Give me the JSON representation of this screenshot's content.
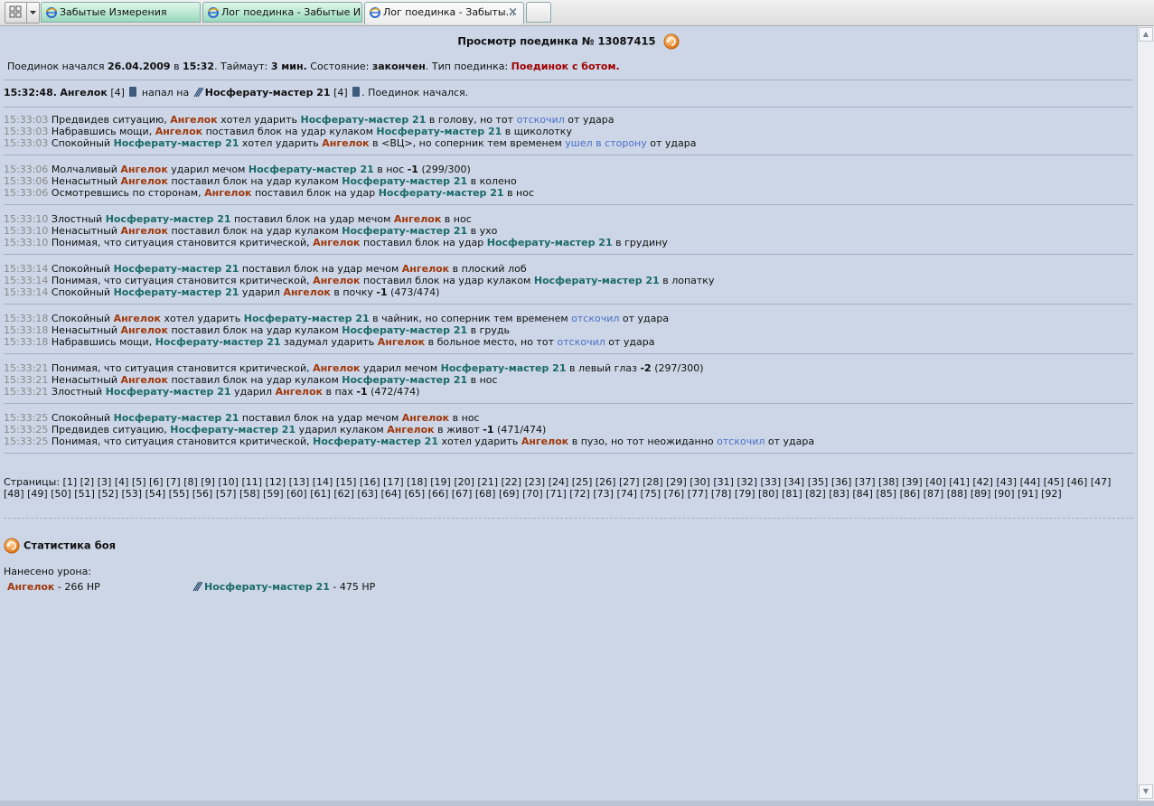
{
  "tabs": [
    {
      "label": "Забытые Измерения",
      "state": "inactive"
    },
    {
      "label": "Лог поединка - Забытые И...",
      "state": "inactive"
    },
    {
      "label": "Лог поединка - Забыты...",
      "state": "active"
    }
  ],
  "colors": {
    "fighter_a": "#a0380c",
    "fighter_b": "#1a6a6a",
    "dodge": "#4a6fc8",
    "page_bg": "#ccd6e6"
  },
  "header": {
    "title": "Просмотр поединка № 13087415"
  },
  "info": {
    "started_label": "Поединок начался",
    "date": "26.04.2009",
    "in_label": "в",
    "time": "15:32",
    "timeout_label": ". Таймаут:",
    "timeout": "3 мин.",
    "state_label": "Состояние:",
    "state": "закончен",
    "type_label": ". Тип поединка:",
    "type": "Поединок с ботом."
  },
  "start": {
    "time": "15:32:48.",
    "fighter_a": "Ангелок",
    "level_a": "[4]",
    "verb": "напал на",
    "fighter_b": "Носферату-мастер 21",
    "level_b": "[4]",
    "suffix": ". Поединок начался."
  },
  "rounds": [
    {
      "lines": [
        {
          "time": "15:33:03",
          "parts": [
            {
              "k": "p",
              "t": "Предвидев ситуацию, "
            },
            {
              "k": "a",
              "t": "Ангелок"
            },
            {
              "k": "p",
              "t": " хотел ударить "
            },
            {
              "k": "n",
              "t": "Носферату-мастер 21"
            },
            {
              "k": "p",
              "t": " в голову, но тот "
            },
            {
              "k": "d",
              "t": "отскочил"
            },
            {
              "k": "p",
              "t": " от удара"
            }
          ]
        },
        {
          "time": "15:33:03",
          "parts": [
            {
              "k": "p",
              "t": "Набравшись мощи, "
            },
            {
              "k": "a",
              "t": "Ангелок"
            },
            {
              "k": "p",
              "t": " поставил блок на удар кулаком "
            },
            {
              "k": "n",
              "t": "Носферату-мастер 21"
            },
            {
              "k": "p",
              "t": " в щиколотку"
            }
          ]
        },
        {
          "time": "15:33:03",
          "parts": [
            {
              "k": "p",
              "t": "Спокойный "
            },
            {
              "k": "n",
              "t": "Носферату-мастер 21"
            },
            {
              "k": "p",
              "t": " хотел ударить "
            },
            {
              "k": "a",
              "t": "Ангелок"
            },
            {
              "k": "p",
              "t": " в <ВЦ>, но соперник тем временем "
            },
            {
              "k": "d",
              "t": "ушел в сторону"
            },
            {
              "k": "p",
              "t": " от удара"
            }
          ]
        }
      ]
    },
    {
      "lines": [
        {
          "time": "15:33:06",
          "parts": [
            {
              "k": "p",
              "t": "Молчаливый "
            },
            {
              "k": "a",
              "t": "Ангелок"
            },
            {
              "k": "p",
              "t": " ударил мечом "
            },
            {
              "k": "n",
              "t": "Носферату-мастер 21"
            },
            {
              "k": "p",
              "t": " в нос "
            },
            {
              "k": "b",
              "t": "-1"
            },
            {
              "k": "p",
              "t": " (299/300)"
            }
          ]
        },
        {
          "time": "15:33:06",
          "parts": [
            {
              "k": "p",
              "t": "Ненасытный "
            },
            {
              "k": "a",
              "t": "Ангелок"
            },
            {
              "k": "p",
              "t": " поставил блок на удар кулаком "
            },
            {
              "k": "n",
              "t": "Носферату-мастер 21"
            },
            {
              "k": "p",
              "t": " в колено"
            }
          ]
        },
        {
          "time": "15:33:06",
          "parts": [
            {
              "k": "p",
              "t": "Осмотревшись по сторонам, "
            },
            {
              "k": "a",
              "t": "Ангелок"
            },
            {
              "k": "p",
              "t": " поставил блок на удар "
            },
            {
              "k": "n",
              "t": "Носферату-мастер 21"
            },
            {
              "k": "p",
              "t": " в нос"
            }
          ]
        }
      ]
    },
    {
      "lines": [
        {
          "time": "15:33:10",
          "parts": [
            {
              "k": "p",
              "t": "Злостный "
            },
            {
              "k": "n",
              "t": "Носферату-мастер 21"
            },
            {
              "k": "p",
              "t": " поставил блок на удар мечом "
            },
            {
              "k": "a",
              "t": "Ангелок"
            },
            {
              "k": "p",
              "t": " в нос"
            }
          ]
        },
        {
          "time": "15:33:10",
          "parts": [
            {
              "k": "p",
              "t": "Ненасытный "
            },
            {
              "k": "a",
              "t": "Ангелок"
            },
            {
              "k": "p",
              "t": " поставил блок на удар кулаком "
            },
            {
              "k": "n",
              "t": "Носферату-мастер 21"
            },
            {
              "k": "p",
              "t": " в ухо"
            }
          ]
        },
        {
          "time": "15:33:10",
          "parts": [
            {
              "k": "p",
              "t": "Понимая, что ситуация становится критической, "
            },
            {
              "k": "a",
              "t": "Ангелок"
            },
            {
              "k": "p",
              "t": " поставил блок на удар "
            },
            {
              "k": "n",
              "t": "Носферату-мастер 21"
            },
            {
              "k": "p",
              "t": " в грудину"
            }
          ]
        }
      ]
    },
    {
      "lines": [
        {
          "time": "15:33:14",
          "parts": [
            {
              "k": "p",
              "t": "Спокойный "
            },
            {
              "k": "n",
              "t": "Носферату-мастер 21"
            },
            {
              "k": "p",
              "t": " поставил блок на удар мечом "
            },
            {
              "k": "a",
              "t": "Ангелок"
            },
            {
              "k": "p",
              "t": " в плоский лоб"
            }
          ]
        },
        {
          "time": "15:33:14",
          "parts": [
            {
              "k": "p",
              "t": "Понимая, что ситуация становится критической, "
            },
            {
              "k": "a",
              "t": "Ангелок"
            },
            {
              "k": "p",
              "t": " поставил блок на удар кулаком "
            },
            {
              "k": "n",
              "t": "Носферату-мастер 21"
            },
            {
              "k": "p",
              "t": " в лопатку"
            }
          ]
        },
        {
          "time": "15:33:14",
          "parts": [
            {
              "k": "p",
              "t": "Спокойный "
            },
            {
              "k": "n",
              "t": "Носферату-мастер 21"
            },
            {
              "k": "p",
              "t": " ударил "
            },
            {
              "k": "a",
              "t": "Ангелок"
            },
            {
              "k": "p",
              "t": " в почку "
            },
            {
              "k": "b",
              "t": "-1"
            },
            {
              "k": "p",
              "t": " (473/474)"
            }
          ]
        }
      ]
    },
    {
      "lines": [
        {
          "time": "15:33:18",
          "parts": [
            {
              "k": "p",
              "t": "Спокойный "
            },
            {
              "k": "a",
              "t": "Ангелок"
            },
            {
              "k": "p",
              "t": " хотел ударить "
            },
            {
              "k": "n",
              "t": "Носферату-мастер 21"
            },
            {
              "k": "p",
              "t": " в чайник, но соперник тем временем "
            },
            {
              "k": "d",
              "t": "отскочил"
            },
            {
              "k": "p",
              "t": " от удара"
            }
          ]
        },
        {
          "time": "15:33:18",
          "parts": [
            {
              "k": "p",
              "t": "Ненасытный "
            },
            {
              "k": "a",
              "t": "Ангелок"
            },
            {
              "k": "p",
              "t": " поставил блок на удар кулаком "
            },
            {
              "k": "n",
              "t": "Носферату-мастер 21"
            },
            {
              "k": "p",
              "t": " в грудь"
            }
          ]
        },
        {
          "time": "15:33:18",
          "parts": [
            {
              "k": "p",
              "t": "Набравшись мощи, "
            },
            {
              "k": "n",
              "t": "Носферату-мастер 21"
            },
            {
              "k": "p",
              "t": " задумал ударить "
            },
            {
              "k": "a",
              "t": "Ангелок"
            },
            {
              "k": "p",
              "t": " в больное место, но тот "
            },
            {
              "k": "d",
              "t": "отскочил"
            },
            {
              "k": "p",
              "t": " от удара"
            }
          ]
        }
      ]
    },
    {
      "lines": [
        {
          "time": "15:33:21",
          "parts": [
            {
              "k": "p",
              "t": "Понимая, что ситуация становится критической, "
            },
            {
              "k": "a",
              "t": "Ангелок"
            },
            {
              "k": "p",
              "t": " ударил мечом "
            },
            {
              "k": "n",
              "t": "Носферату-мастер 21"
            },
            {
              "k": "p",
              "t": " в левый глаз "
            },
            {
              "k": "b",
              "t": "-2"
            },
            {
              "k": "p",
              "t": " (297/300)"
            }
          ]
        },
        {
          "time": "15:33:21",
          "parts": [
            {
              "k": "p",
              "t": "Ненасытный "
            },
            {
              "k": "a",
              "t": "Ангелок"
            },
            {
              "k": "p",
              "t": " поставил блок на удар кулаком "
            },
            {
              "k": "n",
              "t": "Носферату-мастер 21"
            },
            {
              "k": "p",
              "t": " в нос"
            }
          ]
        },
        {
          "time": "15:33:21",
          "parts": [
            {
              "k": "p",
              "t": "Злостный "
            },
            {
              "k": "n",
              "t": "Носферату-мастер 21"
            },
            {
              "k": "p",
              "t": " ударил "
            },
            {
              "k": "a",
              "t": "Ангелок"
            },
            {
              "k": "p",
              "t": " в пах "
            },
            {
              "k": "b",
              "t": "-1"
            },
            {
              "k": "p",
              "t": " (472/474)"
            }
          ]
        }
      ]
    },
    {
      "lines": [
        {
          "time": "15:33:25",
          "parts": [
            {
              "k": "p",
              "t": "Спокойный "
            },
            {
              "k": "n",
              "t": "Носферату-мастер 21"
            },
            {
              "k": "p",
              "t": " поставил блок на удар мечом "
            },
            {
              "k": "a",
              "t": "Ангелок"
            },
            {
              "k": "p",
              "t": " в нос"
            }
          ]
        },
        {
          "time": "15:33:25",
          "parts": [
            {
              "k": "p",
              "t": "Предвидев ситуацию, "
            },
            {
              "k": "n",
              "t": "Носферату-мастер 21"
            },
            {
              "k": "p",
              "t": " ударил кулаком "
            },
            {
              "k": "a",
              "t": "Ангелок"
            },
            {
              "k": "p",
              "t": " в живот "
            },
            {
              "k": "b",
              "t": "-1"
            },
            {
              "k": "p",
              "t": " (471/474)"
            }
          ]
        },
        {
          "time": "15:33:25",
          "parts": [
            {
              "k": "p",
              "t": "Понимая, что ситуация становится критической, "
            },
            {
              "k": "n",
              "t": "Носферату-мастер 21"
            },
            {
              "k": "p",
              "t": " хотел ударить "
            },
            {
              "k": "a",
              "t": "Ангелок"
            },
            {
              "k": "p",
              "t": " в пузо, но тот неожиданно "
            },
            {
              "k": "d",
              "t": "отскочил"
            },
            {
              "k": "p",
              "t": " от удара"
            }
          ]
        }
      ]
    }
  ],
  "pagination": {
    "label": "Страницы:",
    "pages": [
      "1",
      "2",
      "3",
      "4",
      "5",
      "6",
      "7",
      "8",
      "9",
      "10",
      "11",
      "12",
      "13",
      "14",
      "15",
      "16",
      "17",
      "18",
      "19",
      "20",
      "21",
      "22",
      "23",
      "24",
      "25",
      "26",
      "27",
      "28",
      "29",
      "30",
      "31",
      "32",
      "33",
      "34",
      "35",
      "36",
      "37",
      "38",
      "39",
      "40",
      "41",
      "42",
      "43",
      "44",
      "45",
      "46",
      "47",
      "48",
      "49",
      "50",
      "51",
      "52",
      "53",
      "54",
      "55",
      "56",
      "57",
      "58",
      "59",
      "60",
      "61",
      "62",
      "63",
      "64",
      "65",
      "66",
      "67",
      "68",
      "69",
      "70",
      "71",
      "72",
      "73",
      "74",
      "75",
      "76",
      "77",
      "78",
      "79",
      "80",
      "81",
      "82",
      "83",
      "84",
      "85",
      "86",
      "87",
      "88",
      "89",
      "90",
      "91",
      "92"
    ]
  },
  "stats": {
    "title": "Статистика боя",
    "damage_label": "Нанесено урона:",
    "fighter_a": {
      "name": "Ангелок",
      "value": " - 266 HP"
    },
    "fighter_b": {
      "name": "Носферату-мастер 21",
      "value": " - 475 HP"
    }
  }
}
